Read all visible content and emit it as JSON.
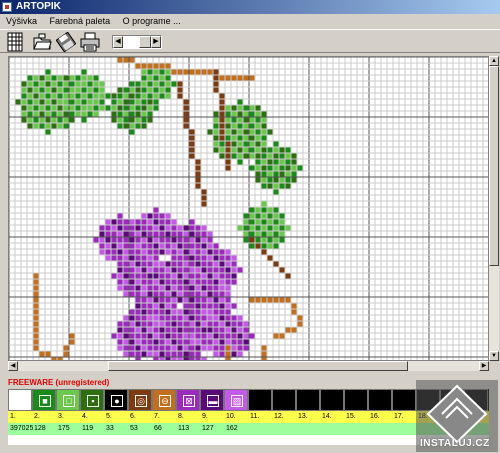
{
  "window": {
    "title": "ARTOPIK"
  },
  "menu": {
    "items": [
      "Výšivka",
      "Farebná paleta",
      "O programe ..."
    ]
  },
  "toolbar": {
    "icons": [
      "grid-icon",
      "open-folder-icon",
      "save-disk-icon",
      "print-icon"
    ]
  },
  "status": {
    "freeware_text": "FREEWARE (unregistered)"
  },
  "palette": {
    "colors": [
      "#ffffff",
      "#1a8a1a",
      "#6cc84c",
      "#2d6e10",
      "#000000",
      "#7a3c10",
      "#c07020",
      "#9c2bbd",
      "#5a0a78",
      "#c65ae8",
      "#000000",
      "#000000",
      "#000000",
      "#000000",
      "#000000",
      "#000000",
      "#000000",
      "#000000",
      "#000000",
      "#000000"
    ],
    "numbers": [
      "1.",
      "2.",
      "3.",
      "4.",
      "5.",
      "6.",
      "7.",
      "8.",
      "9.",
      "10.",
      "11.",
      "12.",
      "13.",
      "14.",
      "15.",
      "16.",
      "17.",
      "18.",
      "19.",
      "20."
    ],
    "counts": [
      "397025",
      "128",
      "175",
      "119",
      "33",
      "53",
      "66",
      "113",
      "127",
      "162",
      "",
      "",
      "",
      "",
      "",
      "",
      "",
      "",
      "",
      ""
    ]
  },
  "watermark": {
    "text": "INSTALUJ.CZ"
  }
}
